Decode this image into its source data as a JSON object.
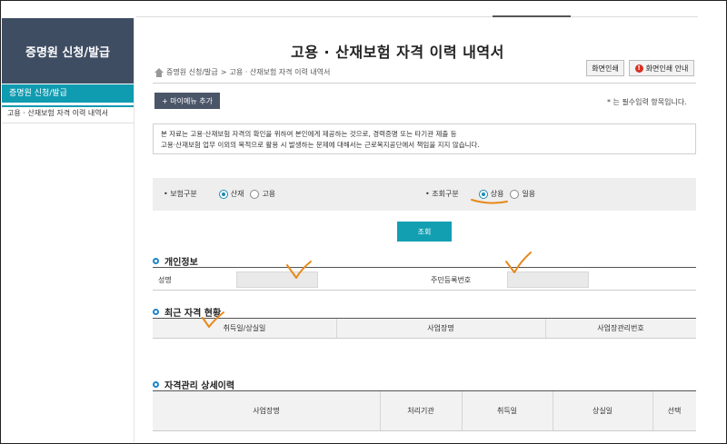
{
  "sidebar": {
    "title": "증명원 신청/발급",
    "selected": "증명원 신청/발급",
    "sub_item": "고용 · 산재보험 자격 이력 내역서"
  },
  "page": {
    "title": "고용 · 산재보험 자격 이력 내역서",
    "breadcrumb": [
      "증명원 신청/발급",
      ">",
      "고용 · 산재보험 자격 이력 내역서"
    ],
    "print_button": "화면인쇄",
    "print_guide_button": "화면인쇄 안내",
    "add_menu_button": "+ 마이메뉴 추가",
    "required_note": "* 는 필수입력 항목입니다."
  },
  "notice": {
    "line1": "본 자료는 고용·산재보험 자격의 확인을 위하여 본인에게 제공하는 것으로, 경력증명 또는 타기관 제출 등",
    "line2": "고용·산재보험 업무 이외의 목적으로 활용 시 발생하는 문제에 대해서는 근로복지공단에서 책임을 지지 않습니다."
  },
  "search": {
    "insurance_label": "• 보험구분",
    "insurance_options": [
      "산재",
      "고용"
    ],
    "insurance_selected": "산재",
    "query_label": "• 조회구분",
    "query_options": [
      "상용",
      "일용"
    ],
    "query_selected": "상용",
    "button": "조회"
  },
  "personal": {
    "section_title": "개인정보",
    "name_label": "성명",
    "name_value": "",
    "rrn_label": "주민등록번호",
    "rrn_value": ""
  },
  "recent": {
    "section_title": "최근 자격 현황",
    "columns": [
      "취득일/상실일",
      "사업장명",
      "사업장관리번호"
    ]
  },
  "detail": {
    "section_title": "자격관리 상세이력",
    "columns": [
      "사업장명",
      "처리기관",
      "취득일",
      "상실일",
      "선택"
    ]
  },
  "colors": {
    "sidebar_header": "#3f4d63",
    "accent": "#0f9bb0",
    "annotation": "#e8891a"
  },
  "icons": [
    "home-icon",
    "info-icon",
    "section-bullet-icon",
    "radio-icon"
  ]
}
